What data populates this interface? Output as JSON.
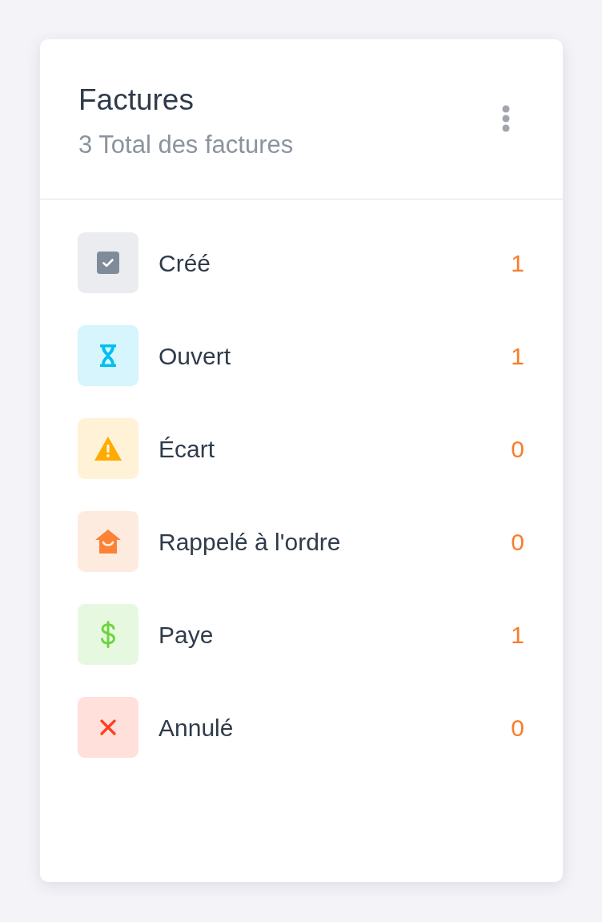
{
  "card": {
    "title": "Factures",
    "subtitle": "3 Total des factures"
  },
  "statuses": [
    {
      "kind": "created",
      "label": "Créé",
      "count": "1",
      "color": "#808b9a"
    },
    {
      "kind": "open",
      "label": "Ouvert",
      "count": "1",
      "color": "#00c0ef"
    },
    {
      "kind": "discrepancy",
      "label": "Écart",
      "count": "0",
      "color": "#ffab00"
    },
    {
      "kind": "reminded",
      "label": "Rappelé à l'ordre",
      "count": "0",
      "color": "#fb8237"
    },
    {
      "kind": "paid",
      "label": "Paye",
      "count": "1",
      "color": "#6bd53d"
    },
    {
      "kind": "cancelled",
      "label": "Annulé",
      "count": "0",
      "color": "#ff3e1d"
    }
  ]
}
